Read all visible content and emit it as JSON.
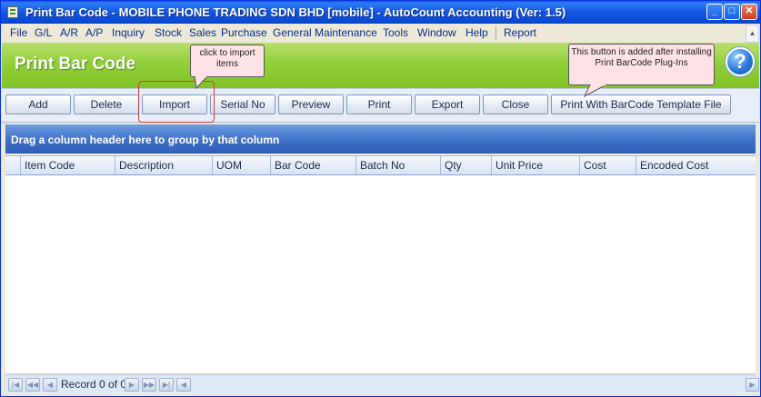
{
  "window": {
    "title": "Print Bar Code - MOBILE PHONE TRADING SDN BHD [mobile] - AutoCount Accounting (Ver: 1.5)",
    "minimize": "_",
    "maximize": "□",
    "close": "✕"
  },
  "menubar": {
    "items": [
      "File",
      "G/L",
      "A/R",
      "A/P",
      "Inquiry",
      "Stock",
      "Sales",
      "Purchase",
      "General Maintenance",
      "Tools",
      "Window",
      "Help",
      "Report"
    ]
  },
  "header": {
    "title": "Print Bar Code",
    "help_glyph": "?"
  },
  "toolbar": {
    "buttons": [
      "Add",
      "Delete",
      "Import",
      "Serial No",
      "Preview",
      "Print",
      "Export",
      "Close",
      "Print With BarCode Template File"
    ]
  },
  "callouts": {
    "import": "click to import items",
    "template": "This button is added after installing Print BarCode Plug-Ins"
  },
  "grid": {
    "group_panel_text": "Drag a column header here to group by that column",
    "columns": [
      "Item Code",
      "Description",
      "UOM",
      "Bar Code",
      "Batch No",
      "Qty",
      "Unit Price",
      "Cost",
      "Encoded Cost"
    ]
  },
  "navigator": {
    "record_text": "Record 0 of 0"
  },
  "icons": {
    "app": "document-icon",
    "help": "help-icon"
  },
  "colors": {
    "titlebar": "#0a5ce8",
    "header_band": "#93cf3a",
    "group_panel": "#3e70c8",
    "callout_bg": "#ffe2e6",
    "highlight_border": "#d23b3b"
  }
}
